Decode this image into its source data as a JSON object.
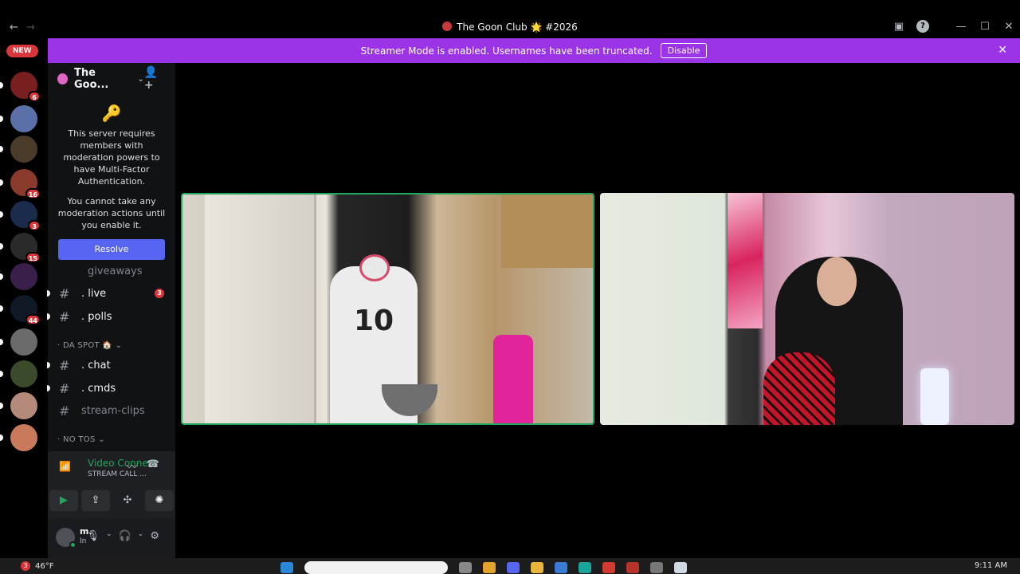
{
  "window": {
    "title": "The Goon Club 🌟 #2026",
    "back": "←",
    "forward": "→",
    "icons": [
      "monitor-icon",
      "help-icon",
      "minimize-icon",
      "maximize-icon",
      "close-icon"
    ],
    "help_glyph": "?",
    "minimize_glyph": "—",
    "maximize_glyph": "☐",
    "close_glyph": "✕",
    "monitor_glyph": "▣"
  },
  "banner": {
    "text": "Streamer Mode is enabled. Usernames have been truncated.",
    "button": "Disable",
    "close": "✕",
    "color": "#9b33e6"
  },
  "servers": {
    "new_label": "NEW",
    "items": [
      {
        "badge": "6",
        "color": "#7a1f1f"
      },
      {
        "badge": "",
        "color": "#5b6fa8"
      },
      {
        "badge": "",
        "color": "#4b3b2b"
      },
      {
        "badge": "16",
        "color": "#8a3a2a"
      },
      {
        "badge": "3",
        "color": "#1b2b4b"
      },
      {
        "badge": "15",
        "color": "#2a2a2a"
      },
      {
        "badge": "",
        "color": "#3b1f4b"
      },
      {
        "badge": "44",
        "color": "#0f1a26"
      },
      {
        "badge": "",
        "color": "#6b6b6b"
      },
      {
        "badge": "",
        "color": "#3a4a2a"
      },
      {
        "badge": "",
        "color": "#b58a7a"
      },
      {
        "badge": "",
        "color": "#c87a5a"
      }
    ]
  },
  "guild": {
    "name": "The Goo...",
    "chevron": "⌄",
    "invite": "👤+"
  },
  "mfa": {
    "icon": "🔑",
    "line1": "This server requires members with moderation powers to have Multi-Factor Authentication.",
    "line2": "You cannot take any moderation actions until you enable it.",
    "button": "Resolve"
  },
  "channels": {
    "giveaways": "giveaways",
    "live": ". live",
    "live_badge": "3",
    "polls": ". polls",
    "cat_spot": "· DA SPOT 🏠 ⌄",
    "chat": ". chat",
    "cmds": ". cmds",
    "stream_clips": "stream-clips",
    "cat_notos": "· NO TOS ⌄",
    "hash": "#"
  },
  "voice": {
    "status_title": "Video Connected",
    "status_sub": "STREAM CALL ...",
    "signal_glyph": "📶",
    "noise_glyph": "〰",
    "disconnect_glyph": "☎"
  },
  "voice_buttons": {
    "camera": "▶",
    "share": "⇪",
    "activity": "✣",
    "soundboard": "✺"
  },
  "user": {
    "name": "m.",
    "status": "In",
    "mic": "🎙",
    "headset": "🎧",
    "settings": "⚙",
    "caret": "⌄"
  },
  "tiles": {
    "jersey_number": "10",
    "speaking_color": "#23a55a"
  },
  "taskbar": {
    "weather_badge": "3",
    "weather": "46°F",
    "clock": "9:11 AM"
  }
}
